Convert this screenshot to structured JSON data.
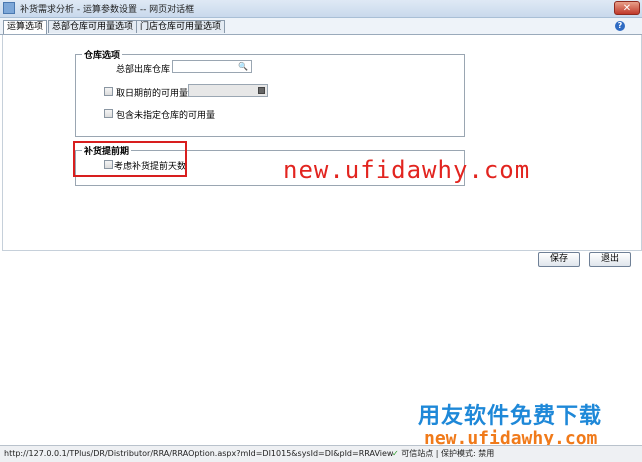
{
  "window": {
    "title": "补货需求分析 - 运算参数设置 -- 网页对话框",
    "close_glyph": "✕"
  },
  "tabs": [
    {
      "label": "运算选项",
      "active": true
    },
    {
      "label": "总部仓库可用量选项",
      "active": false
    },
    {
      "label": "门店仓库可用量选项",
      "active": false
    }
  ],
  "help_glyph": "?",
  "warehouse_options": {
    "legend": "仓库选项",
    "hq_outbound_label": "总部出库仓库",
    "hq_outbound_value": "",
    "search_glyph": "🔍",
    "date_available_label": "取日期前的可用量",
    "date_available_checked": false,
    "include_unassigned_label": "包含未指定仓库的可用量",
    "include_unassigned_checked": false
  },
  "leadtime": {
    "legend": "补货提前期",
    "consider_leadtime_label": "考虑补货提前天数",
    "consider_leadtime_checked": false
  },
  "buttons": {
    "save": "保存",
    "exit": "退出"
  },
  "watermarks": {
    "center_url": "new.ufidawhy.com",
    "brand_cn": "用友软件免费下载",
    "brand_url": "new.ufidawhy.com"
  },
  "statusbar": {
    "url": "http://127.0.0.1/TPlus/DR/Distributor/RRA/RRAOption.aspx?mId=DI1015&sysId=DI&pId=RRAView",
    "zone": "可信站点 | 保护模式: 禁用"
  },
  "colors": {
    "highlight_box": "#d81e1e",
    "watermark_red": "#e2241f",
    "brand_blue": "#1e88d8",
    "brand_orange": "#f07a1a"
  }
}
